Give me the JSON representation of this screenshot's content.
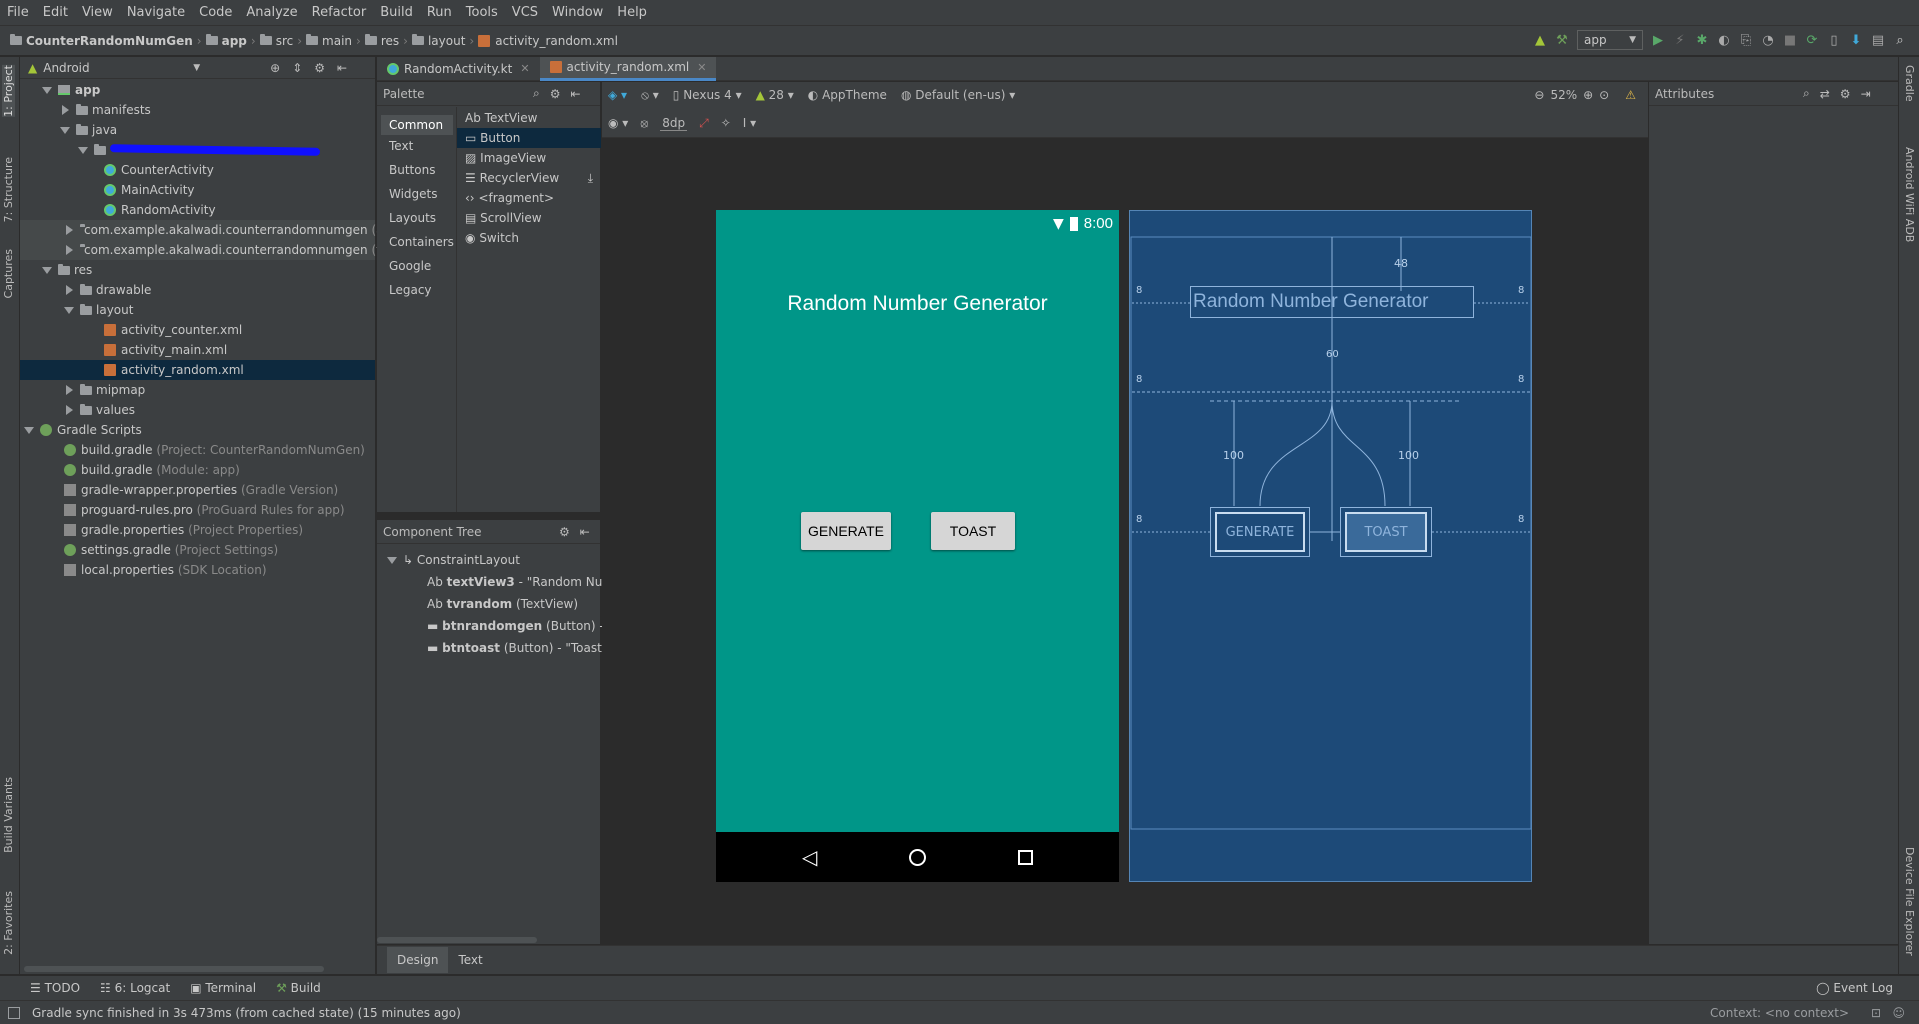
{
  "menu": [
    "File",
    "Edit",
    "View",
    "Navigate",
    "Code",
    "Analyze",
    "Refactor",
    "Build",
    "Run",
    "Tools",
    "VCS",
    "Window",
    "Help"
  ],
  "breadcrumb": [
    "CounterRandomNumGen",
    "app",
    "src",
    "main",
    "res",
    "layout",
    "activity_random.xml"
  ],
  "run_config": "app",
  "side_tabs_left": [
    "1: Project",
    "7: Structure",
    "Captures",
    "Build Variants",
    "2: Favorites"
  ],
  "side_tabs_right": [
    "Gradle",
    "Android WiFi ADB",
    "Device File Explorer"
  ],
  "project": {
    "view_mode": "Android",
    "tree": [
      {
        "label": "app",
        "extra": ""
      },
      {
        "label": "manifests",
        "extra": ""
      },
      {
        "label": "java",
        "extra": ""
      },
      {
        "label": "CounterActivity",
        "extra": ""
      },
      {
        "label": "MainActivity",
        "extra": ""
      },
      {
        "label": "RandomActivity",
        "extra": ""
      },
      {
        "label": "com.example.akalwadi.counterrandomnumgen",
        "extra": "(an"
      },
      {
        "label": "com.example.akalwadi.counterrandomnumgen",
        "extra": "(tes"
      },
      {
        "label": "res",
        "extra": ""
      },
      {
        "label": "drawable",
        "extra": ""
      },
      {
        "label": "layout",
        "extra": ""
      },
      {
        "label": "activity_counter.xml",
        "extra": ""
      },
      {
        "label": "activity_main.xml",
        "extra": ""
      },
      {
        "label": "activity_random.xml",
        "extra": ""
      },
      {
        "label": "mipmap",
        "extra": ""
      },
      {
        "label": "values",
        "extra": ""
      },
      {
        "label": "Gradle Scripts",
        "extra": ""
      },
      {
        "label": "build.gradle",
        "extra": "(Project: CounterRandomNumGen)"
      },
      {
        "label": "build.gradle",
        "extra": "(Module: app)"
      },
      {
        "label": "gradle-wrapper.properties",
        "extra": "(Gradle Version)"
      },
      {
        "label": "proguard-rules.pro",
        "extra": "(ProGuard Rules for app)"
      },
      {
        "label": "gradle.properties",
        "extra": "(Project Properties)"
      },
      {
        "label": "settings.gradle",
        "extra": "(Project Settings)"
      },
      {
        "label": "local.properties",
        "extra": "(SDK Location)"
      }
    ]
  },
  "tabs": [
    {
      "label": "RandomActivity.kt",
      "active": false
    },
    {
      "label": "activity_random.xml",
      "active": true
    }
  ],
  "palette": {
    "title": "Palette",
    "categories": [
      "Common",
      "Text",
      "Buttons",
      "Widgets",
      "Layouts",
      "Containers",
      "Google",
      "Legacy"
    ],
    "items": [
      "TextView",
      "Button",
      "ImageView",
      "RecyclerView",
      "<fragment>",
      "ScrollView",
      "Switch"
    ],
    "item_prefix_textview": "Ab"
  },
  "component_tree": {
    "title": "Component Tree",
    "root": "ConstraintLayout",
    "children": [
      {
        "prefix": "Ab",
        "id": "textView3",
        "desc": " - \"Random Numb"
      },
      {
        "prefix": "Ab",
        "id": "tvrandom",
        "desc": " (TextView)"
      },
      {
        "prefix": "",
        "id": "btnrandomgen",
        "desc": " (Button) - \"Ge"
      },
      {
        "prefix": "",
        "id": "btntoast",
        "desc": " (Button) - \"Toast\""
      }
    ]
  },
  "design_toolbar": {
    "device": "Nexus 4",
    "api": "28",
    "theme": "AppTheme",
    "locale": "Default (en-us)",
    "zoom": "52%",
    "margin": "8dp"
  },
  "attributes_title": "Attributes",
  "device_preview": {
    "time": "8:00",
    "title": "Random Number Generator",
    "btn_generate": "GENERATE",
    "btn_toast": "TOAST"
  },
  "blueprint": {
    "title": "Random Number Generator",
    "btn_generate": "GENERATE",
    "btn_toast": "TOAST",
    "dim_top": "48",
    "dim_mid": "60",
    "dim_left": "100",
    "dim_right": "100",
    "margin": "8"
  },
  "design_tabs": [
    "Design",
    "Text"
  ],
  "bottom_tools": [
    "TODO",
    "6: Logcat",
    "Terminal",
    "Build"
  ],
  "event_log": "Event Log",
  "status": "Gradle sync finished in 3s 473ms (from cached state) (15 minutes ago)",
  "context": "Context: <no context>",
  "colors": {
    "accent": "#4a88c7",
    "device_bg": "#009688",
    "blueprint_bg": "#1d4a78"
  }
}
